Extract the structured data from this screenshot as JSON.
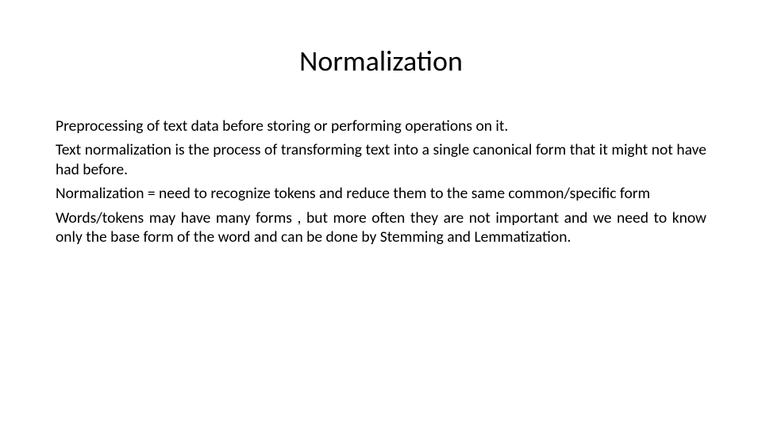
{
  "slide": {
    "title": "Normalization",
    "paragraphs": {
      "p1": "Preprocessing of text data before storing or performing operations on it.",
      "p2": "Text normalization is the process of transforming text into a single canonical form that it might not have had before.",
      "p3": "Normalization = need to recognize tokens and reduce them to the same common/specific form",
      "p4": "Words/tokens may have many forms , but more often they are not important and we need to know only the base form of the word and can be done by Stemming and Lemmatization."
    }
  }
}
